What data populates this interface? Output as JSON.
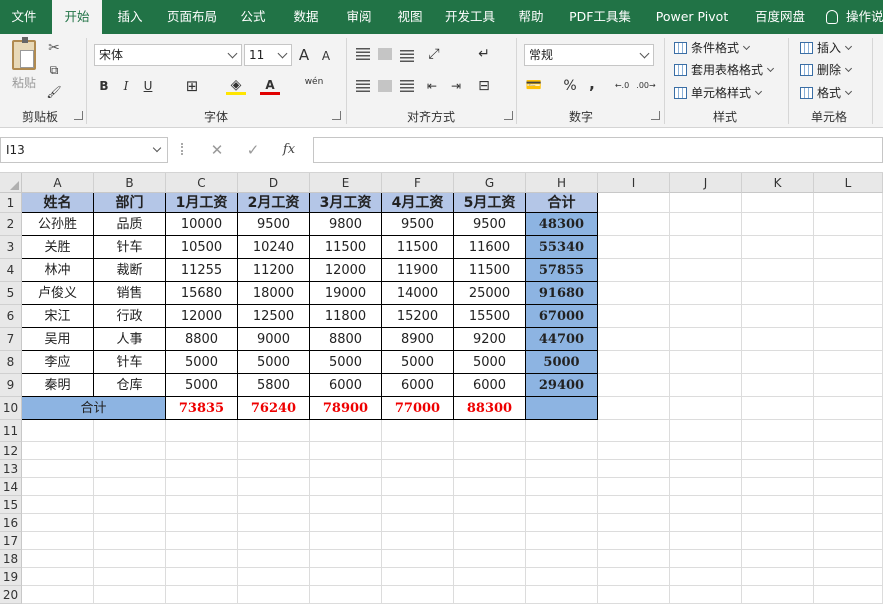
{
  "tabs": [
    "文件",
    "开始",
    "插入",
    "页面布局",
    "公式",
    "数据",
    "审阅",
    "视图",
    "开发工具",
    "帮助",
    "PDF工具集",
    "Power Pivot",
    "百度网盘"
  ],
  "tell_me": "操作说明搜索",
  "ribbon": {
    "paste_label": "粘贴",
    "font_name": "宋体",
    "font_size": "11",
    "bold": "B",
    "italic": "I",
    "underline": "U",
    "inc_font": "A",
    "dec_font": "A",
    "wen": "wén",
    "number_format": "常规",
    "percent": "%",
    "comma": ",",
    "cond_format": "条件格式",
    "table_format": "套用表格格式",
    "cell_style": "单元格样式",
    "insert": "插入",
    "delete": "删除",
    "format": "格式",
    "groups": [
      "剪贴板",
      "字体",
      "对齐方式",
      "数字",
      "样式",
      "单元格"
    ]
  },
  "formula_bar": {
    "name_box": "I13",
    "cancel": "✕",
    "enter": "✓",
    "fx": "fx",
    "value": ""
  },
  "columns": [
    "A",
    "B",
    "C",
    "D",
    "E",
    "F",
    "G",
    "H",
    "I",
    "J",
    "K",
    "L"
  ],
  "rows": [
    "1",
    "2",
    "3",
    "4",
    "5",
    "6",
    "7",
    "8",
    "9",
    "10",
    "11",
    "12",
    "13",
    "14",
    "15",
    "16",
    "17",
    "18",
    "19",
    "20"
  ],
  "table": {
    "headers": [
      "姓名",
      "部门",
      "1月工资",
      "2月工资",
      "3月工资",
      "4月工资",
      "5月工资",
      "合计"
    ],
    "body": [
      [
        "公孙胜",
        "品质",
        "10000",
        "9500",
        "9800",
        "9500",
        "9500",
        "48300"
      ],
      [
        "关胜",
        "针车",
        "10500",
        "10240",
        "11500",
        "11500",
        "11600",
        "55340"
      ],
      [
        "林冲",
        "裁断",
        "11255",
        "11200",
        "12000",
        "11900",
        "11500",
        "57855"
      ],
      [
        "卢俊义",
        "销售",
        "15680",
        "18000",
        "19000",
        "14000",
        "25000",
        "91680"
      ],
      [
        "宋江",
        "行政",
        "12000",
        "12500",
        "11800",
        "15200",
        "15500",
        "67000"
      ],
      [
        "吴用",
        "人事",
        "8800",
        "9000",
        "8800",
        "8900",
        "9200",
        "44700"
      ],
      [
        "李应",
        "针车",
        "5000",
        "5000",
        "5000",
        "5000",
        "5000",
        "5000"
      ],
      [
        "秦明",
        "仓库",
        "5000",
        "5800",
        "6000",
        "6000",
        "6000",
        "29400"
      ]
    ],
    "total_label": "合计",
    "totals": [
      "73835",
      "76240",
      "78900",
      "77000",
      "88300"
    ]
  },
  "colors": {
    "ribbon_green": "#217346",
    "header_fill": "#b4c6e7",
    "total_fill": "#8db4e2",
    "total_text": "#ee0000"
  }
}
